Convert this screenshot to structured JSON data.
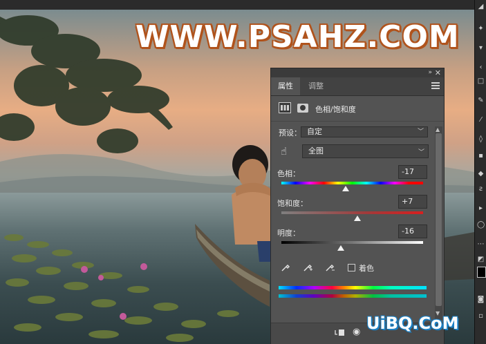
{
  "watermark": {
    "text": "WWW.PSAHZ.COM"
  },
  "corner_watermark": {
    "text": "UiBQ.CoM"
  },
  "panel": {
    "tabs": [
      {
        "label": "属性"
      },
      {
        "label": "调整"
      }
    ],
    "adjustment_title": "色相/饱和度",
    "preset_label": "预设：",
    "preset_value": "自定",
    "channel_value": "全图",
    "hue": {
      "label": "色相：",
      "value": "-17",
      "level": -17
    },
    "saturation": {
      "label": "饱和度：",
      "value": "+7",
      "level": 7
    },
    "lightness": {
      "label": "明度：",
      "value": "-16",
      "level": -16
    },
    "colorize_label": "着色",
    "colorize_checked": false
  },
  "icons": {
    "collapse": "double-chevron-icon",
    "close": "close-icon",
    "menu": "hamburger-menu-icon",
    "hand": "hand-drag-icon",
    "eyedropper": "eyedropper-icon",
    "eyedropper_plus": "eyedropper-add-icon",
    "eyedropper_minus": "eyedropper-subtract-icon",
    "visibility": "eye-icon",
    "clip": "clip-to-layer-icon"
  }
}
